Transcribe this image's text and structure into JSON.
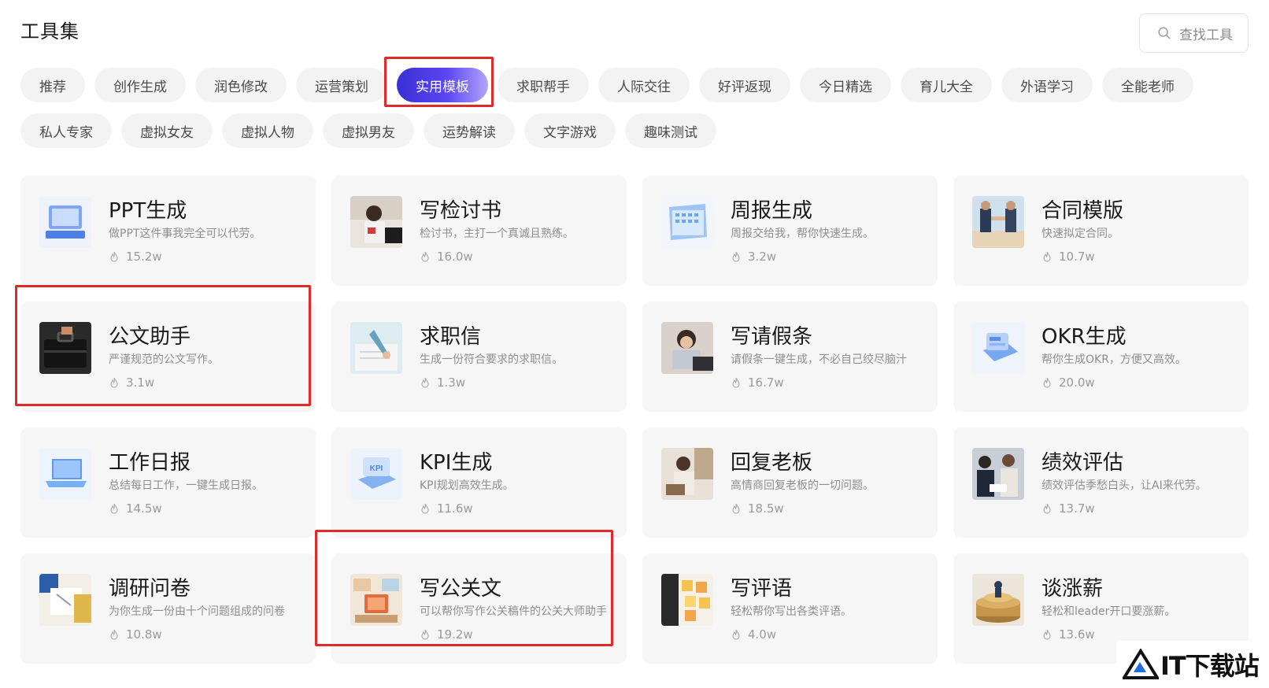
{
  "header": {
    "title": "工具集"
  },
  "search": {
    "placeholder": "查找工具",
    "icon": "search-icon"
  },
  "accent_color": "#4b3ae8",
  "categories": {
    "row1": [
      {
        "label": "推荐"
      },
      {
        "label": "创作生成"
      },
      {
        "label": "润色修改"
      },
      {
        "label": "运营策划"
      },
      {
        "label": "实用模板",
        "active": true
      },
      {
        "label": "求职帮手"
      },
      {
        "label": "人际交往"
      },
      {
        "label": "好评返现"
      },
      {
        "label": "今日精选"
      },
      {
        "label": "育儿大全"
      },
      {
        "label": "外语学习"
      },
      {
        "label": "全能老师"
      }
    ],
    "row2": [
      {
        "label": "私人专家"
      },
      {
        "label": "虚拟女友"
      },
      {
        "label": "虚拟人物"
      },
      {
        "label": "虚拟男友"
      },
      {
        "label": "运势解读"
      },
      {
        "label": "文字游戏"
      },
      {
        "label": "趣味测试"
      }
    ]
  },
  "cards": [
    {
      "title": "PPT生成",
      "desc": "做PPT这件事我完全可以代劳。",
      "count": "15.2w",
      "thumb": "ppt-thumbnail"
    },
    {
      "title": "写检讨书",
      "desc": "检讨书，主打一个真诚且熟练。",
      "count": "16.0w",
      "thumb": "self-review-thumbnail"
    },
    {
      "title": "周报生成",
      "desc": "周报交给我，帮你快速生成。",
      "count": "3.2w",
      "thumb": "calendar-thumbnail"
    },
    {
      "title": "合同模版",
      "desc": "快速拟定合同。",
      "count": "10.7w",
      "thumb": "handshake-thumbnail"
    },
    {
      "title": "公文助手",
      "desc": "严谨规范的公文写作。",
      "count": "3.1w",
      "thumb": "briefcase-thumbnail"
    },
    {
      "title": "求职信",
      "desc": "生成一份符合要求的求职信。",
      "count": "1.3w",
      "thumb": "writing-thumbnail"
    },
    {
      "title": "写请假条",
      "desc": "请假条一键生成，不必自己绞尽脑汁",
      "count": "16.7w",
      "thumb": "tired-girl-thumbnail"
    },
    {
      "title": "OKR生成",
      "desc": "帮你生成OKR，方便又高效。",
      "count": "20.0w",
      "thumb": "okr-thumbnail"
    },
    {
      "title": "工作日报",
      "desc": "总结每日工作，一键生成日报。",
      "count": "14.5w",
      "thumb": "laptop-thumbnail"
    },
    {
      "title": "KPI生成",
      "desc": "KPI规划高效生成。",
      "count": "11.6w",
      "thumb": "kpi-thumbnail"
    },
    {
      "title": "回复老板",
      "desc": "高情商回复老板的一切问题。",
      "count": "18.5w",
      "thumb": "office-woman-thumbnail"
    },
    {
      "title": "绩效评估",
      "desc": "绩效评估季愁白头，让AI来代劳。",
      "count": "13.7w",
      "thumb": "meeting-thumbnail"
    },
    {
      "title": "调研问卷",
      "desc": "为你生成一份由十个问题组成的问卷",
      "count": "10.8w",
      "thumb": "survey-thumbnail"
    },
    {
      "title": "写公关文",
      "desc": "可以帮你写作公关稿件的公关大师助手",
      "count": "19.2w",
      "thumb": "pr-room-thumbnail"
    },
    {
      "title": "写评语",
      "desc": "轻松帮你写出各类评语。",
      "count": "4.0w",
      "thumb": "sticky-notes-thumbnail"
    },
    {
      "title": "谈涨薪",
      "desc": "轻松和leader开口要涨薪。",
      "count": "13.6w",
      "thumb": "coins-thumbnail"
    }
  ],
  "watermark": {
    "text": "IT下载站"
  }
}
